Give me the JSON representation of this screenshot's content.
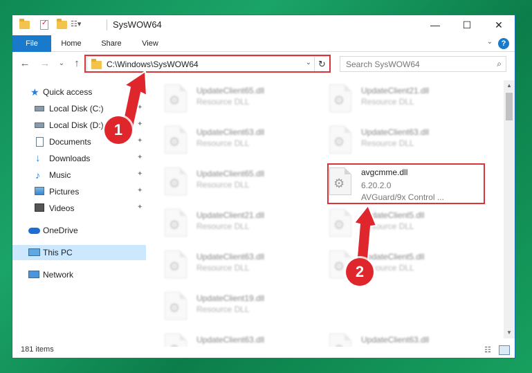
{
  "window": {
    "title": "SysWOW64",
    "controls": {
      "minimize": "—",
      "maximize": "☐",
      "close": "✕"
    }
  },
  "ribbon": {
    "tabs": [
      "File",
      "Home",
      "Share",
      "View"
    ],
    "help": "?",
    "expand": "⌄"
  },
  "address": {
    "path": "C:\\Windows\\SysWOW64",
    "refresh": "↻",
    "dropdown": "⌄"
  },
  "search": {
    "placeholder": "Search SysWOW64",
    "icon": "⌕"
  },
  "nav_buttons": {
    "back": "←",
    "forward": "→",
    "recent": "⌄",
    "up": "↑"
  },
  "sidebar": {
    "items": [
      {
        "label": "Quick access",
        "icon": "star-icon",
        "pinned": false
      },
      {
        "label": "Local Disk (C:)",
        "icon": "drive-icon",
        "pinned": true
      },
      {
        "label": "Local Disk (D:)",
        "icon": "drive-icon",
        "pinned": true
      },
      {
        "label": "Documents",
        "icon": "documents-icon",
        "pinned": true
      },
      {
        "label": "Downloads",
        "icon": "download-icon",
        "pinned": true
      },
      {
        "label": "Music",
        "icon": "music-icon",
        "pinned": true
      },
      {
        "label": "Pictures",
        "icon": "pictures-icon",
        "pinned": true
      },
      {
        "label": "Videos",
        "icon": "videos-icon",
        "pinned": true
      },
      {
        "label": "OneDrive",
        "icon": "onedrive-icon",
        "pinned": false
      },
      {
        "label": "This PC",
        "icon": "this-pc-icon",
        "pinned": false,
        "selected": true
      },
      {
        "label": "Network",
        "icon": "network-icon",
        "pinned": false
      }
    ],
    "pin_glyph": "📌"
  },
  "files": {
    "left_column": [
      {
        "name": "UpdateClient65.dll",
        "type": "Resource DLL"
      },
      {
        "name": "UpdateClient63.dll",
        "type": "Resource DLL"
      },
      {
        "name": "UpdateClient65.dll",
        "type": "Resource DLL"
      },
      {
        "name": "UpdateClient21.dll",
        "type": "Resource DLL"
      },
      {
        "name": "UpdateClient63.dll",
        "type": "Resource DLL"
      },
      {
        "name": "UpdateClient19.dll",
        "type": "Resource DLL"
      },
      {
        "name": "UpdateClient63.dll",
        "type": "Resource DLL"
      }
    ],
    "right_column": [
      {
        "name": "UpdateClient21.dll",
        "type": "Resource DLL"
      },
      {
        "name": "UpdateClient63.dll",
        "type": "Resource DLL"
      },
      {
        "name": "avgcmme.dll",
        "version": "6.20.2.0",
        "description": "AVGuard/9x Control ...",
        "highlighted": true
      },
      {
        "name": "UpdateClient5.dll",
        "type": "Resource DLL"
      },
      {
        "name": "UpdateClient5.dll",
        "type": "Resource DLL"
      },
      {
        "name": "UpdateClient63.dll",
        "type": "Resource DLL"
      }
    ]
  },
  "status": {
    "item_count": "181 items"
  },
  "annotations": {
    "badge_1": "1",
    "badge_2": "2",
    "color": "#d9343a"
  },
  "colors": {
    "accent": "#1979ca",
    "selection": "#cce8ff",
    "annotation_red": "#e0262d"
  }
}
